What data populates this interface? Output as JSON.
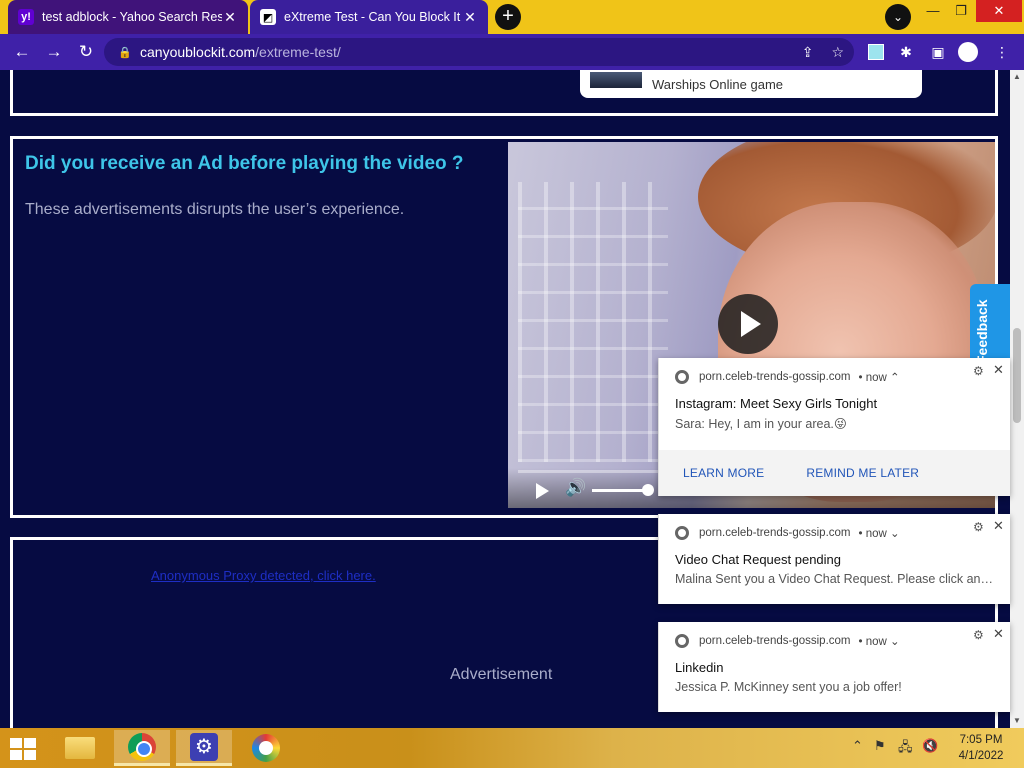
{
  "browser": {
    "tabs": [
      {
        "favicon": "y!",
        "title": "test adblock - Yahoo Search Results",
        "close": "✕"
      },
      {
        "favicon": "◩",
        "title": "eXtreme Test - Can You Block It ?",
        "close": "✕"
      }
    ],
    "new_tab": "+",
    "tab_search": "⌄",
    "window": {
      "minimize": "—",
      "restore": "❐",
      "close": "✕"
    },
    "nav": {
      "back": "←",
      "forward": "→",
      "reload": "↻"
    },
    "url_host": "canyoublockit.com",
    "url_path": "/extreme-test/",
    "lock": "🔒",
    "share": "⇪",
    "bookmark": "☆",
    "extensions": "✱",
    "sidepanel": "▣",
    "menu": "⋮"
  },
  "page": {
    "top_ad_text": "Warships Online game",
    "question": "Did you receive an Ad before playing the video ?",
    "description": "These advertisements disrupts the user’s experience.",
    "anon_link": "Anonymous Proxy detected, click here.",
    "advertisement": "Advertisement",
    "feedback": "Feedback"
  },
  "notifications": [
    {
      "site": "porn.celeb-trends-gossip.com",
      "time": "• now ⌃",
      "title": "Instagram: Meet Sexy Girls Tonight",
      "body": "Sara: Hey, I am in your area.😜",
      "actions": [
        "LEARN MORE",
        "REMIND ME LATER"
      ]
    },
    {
      "site": "porn.celeb-trends-gossip.com",
      "time": "• now ⌄",
      "title": "Video Chat Request pending",
      "body": "Malina Sent you a Video Chat Request. Please click an…"
    },
    {
      "site": "porn.celeb-trends-gossip.com",
      "time": "• now ⌄",
      "title": "Linkedin",
      "body": "Jessica P. McKinney sent you a job offer!"
    }
  ],
  "taskbar": {
    "tray_up": "⌃",
    "time": "7:05 PM",
    "date": "4/1/2022"
  }
}
